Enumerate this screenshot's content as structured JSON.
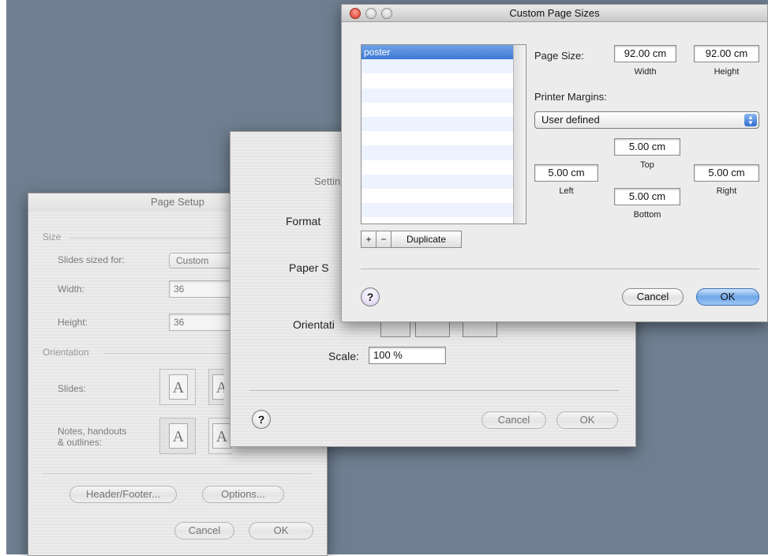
{
  "page_setup": {
    "title": "Page Setup",
    "size_section": "Size",
    "slides_sized_for_label": "Slides sized for:",
    "slides_sized_for_value": "Custom",
    "width_label": "Width:",
    "width_value": "36",
    "height_label": "Height:",
    "height_value": "36",
    "orientation_section": "Orientation",
    "slides_label": "Slides:",
    "notes_label": "Notes, handouts\n& outlines:",
    "header_footer_button": "Header/Footer...",
    "options_button": "Options...",
    "cancel_button": "Cancel",
    "ok_button": "OK",
    "orient_glyph": "A"
  },
  "settings": {
    "title_fragment": "Settin",
    "format_label": "Format",
    "paper_size_label": "Paper S",
    "orientation_label": "Orientati",
    "scale_label": "Scale:",
    "scale_value": "100 %",
    "help_glyph": "?",
    "cancel_button": "Cancel",
    "ok_button": "OK"
  },
  "custom_page_sizes": {
    "title": "Custom Page Sizes",
    "list_items": [
      "poster"
    ],
    "add_button": "+",
    "remove_button": "−",
    "duplicate_button": "Duplicate",
    "page_size_label": "Page Size:",
    "width_value": "92.00 cm",
    "width_caption": "Width",
    "height_value": "92.00 cm",
    "height_caption": "Height",
    "printer_margins_label": "Printer Margins:",
    "margins_select": "User defined",
    "top_value": "5.00 cm",
    "top_caption": "Top",
    "left_value": "5.00 cm",
    "left_caption": "Left",
    "right_value": "5.00 cm",
    "right_caption": "Right",
    "bottom_value": "5.00 cm",
    "bottom_caption": "Bottom",
    "help_glyph": "?",
    "cancel_button": "Cancel",
    "ok_button": "OK"
  }
}
